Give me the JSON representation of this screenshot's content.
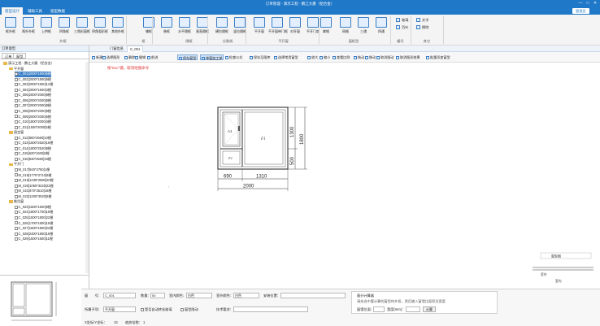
{
  "app": {
    "title": "订单管理 - 演示工程 - 鹏江大厦（铝合金）"
  },
  "window": {
    "min_icon": "minimize-icon",
    "max_icon": "maximize-icon",
    "close_icon": "close-icon",
    "min_glyph": "—",
    "max_glyph": "□",
    "close_glyph": "✕"
  },
  "tabs": [
    {
      "label": "窗型设计",
      "active": true
    },
    {
      "label": "辅助工具",
      "active": false
    },
    {
      "label": "窗型数据",
      "active": false
    }
  ],
  "user": {
    "label": "管理员"
  },
  "ribbon": {
    "buttons": [
      {
        "label": "框外框",
        "icon": "frame-icon"
      },
      {
        "label": "两外外框",
        "icon": "double-frame-icon"
      },
      {
        "label": "上拱框",
        "icon": "arch-frame-icon"
      },
      {
        "label": "四角框",
        "icon": "corner-frame-icon"
      },
      {
        "label": "三角形窗框",
        "icon": "triangle-frame-icon"
      },
      {
        "label": "四角弧形框",
        "icon": "arc-frame-icon"
      },
      {
        "label": "其他外框",
        "icon": "other-frame-icon"
      },
      {
        "label": "辅框",
        "icon": "aux-frame-icon"
      },
      {
        "label": "装框",
        "icon": "mount-frame-icon"
      },
      {
        "label": "水平隔框",
        "icon": "h-split-icon"
      },
      {
        "label": "垂直隔框",
        "icon": "v-split-icon"
      },
      {
        "label": "横拉隔框",
        "icon": "h-slide-icon"
      },
      {
        "label": "竖拉隔框",
        "icon": "v-slide-icon"
      },
      {
        "label": "平开窗",
        "icon": "casement-icon"
      },
      {
        "label": "平开窗带门框",
        "icon": "casement-door-icon"
      },
      {
        "label": "对开窗",
        "icon": "double-open-icon"
      },
      {
        "label": "平开门扇",
        "icon": "door-sash-icon"
      },
      {
        "label": "掌格",
        "icon": "grid-icon"
      },
      {
        "label": "网格",
        "icon": "mesh-icon"
      },
      {
        "label": "三通",
        "icon": "tee-icon"
      },
      {
        "label": "四通",
        "icon": "cross-icon"
      }
    ],
    "groups": [
      {
        "label": "外框"
      },
      {
        "label": "框"
      },
      {
        "label": "隔框"
      },
      {
        "label": "分割线"
      },
      {
        "label": "平开窗"
      },
      {
        "label": "窗框型"
      },
      {
        "label": "编号"
      },
      {
        "label": "其它"
      }
    ],
    "small": [
      {
        "label": "玻璃"
      },
      {
        "label": "百叶"
      },
      {
        "label": "文字"
      },
      {
        "label": "擦除"
      }
    ]
  },
  "leftpanel": {
    "header": "订单窗型",
    "subtabs": [
      {
        "label": "订单"
      },
      {
        "label": "窗型"
      }
    ],
    "tree": [
      {
        "label": "演示工程 - 鹏江大厦（铝合金）",
        "level": 0,
        "type": "folder"
      },
      {
        "label": "平开窗",
        "level": 1,
        "type": "folder"
      },
      {
        "label": "C_001[2000*1800]6樘",
        "level": 2,
        "type": "doc",
        "selected": true
      },
      {
        "label": "C_002[2000*1800]8樘",
        "level": 2,
        "type": "doc"
      },
      {
        "label": "C_003[2000*1800]12樘",
        "level": 2,
        "type": "doc"
      },
      {
        "label": "C_004[2000*1500]4樘",
        "level": 2,
        "type": "doc"
      },
      {
        "label": "C_005[2000*2000]8樘",
        "level": 2,
        "type": "doc"
      },
      {
        "label": "C_006[2000*2000]8樘",
        "level": 2,
        "type": "doc"
      },
      {
        "label": "C_007[2000*2000]8樘",
        "level": 2,
        "type": "doc"
      },
      {
        "label": "C_008[2000*2000]8樘",
        "level": 2,
        "type": "doc"
      },
      {
        "label": "C_009[2000*2000]6樘",
        "level": 2,
        "type": "doc"
      },
      {
        "label": "C_010[1800*2000]4樘",
        "level": 2,
        "type": "doc"
      },
      {
        "label": "C_011[1500*2000]5樘",
        "level": 2,
        "type": "doc"
      },
      {
        "label": "固定窗",
        "level": 1,
        "type": "folder"
      },
      {
        "label": "C_012[800*2560]10樘",
        "level": 2,
        "type": "doc"
      },
      {
        "label": "C_013[1500*2520]18樘",
        "level": 2,
        "type": "doc"
      },
      {
        "label": "C_014[1800*2520]8樘",
        "level": 2,
        "type": "doc"
      },
      {
        "label": "C_015[620*1600]8樘",
        "level": 2,
        "type": "doc"
      },
      {
        "label": "C_016[840*2560]18樘",
        "level": 2,
        "type": "doc"
      },
      {
        "label": "平开门",
        "level": 1,
        "type": "folder"
      },
      {
        "label": "M_017[840*2750]1樘",
        "level": 2,
        "type": "doc"
      },
      {
        "label": "M_018[1770*2710]8樘",
        "level": 2,
        "type": "doc"
      },
      {
        "label": "M_019[1438*2890]20樘",
        "level": 2,
        "type": "doc"
      },
      {
        "label": "M_020[1050*3225]22樘",
        "level": 2,
        "type": "doc"
      },
      {
        "label": "M_021[870*2510]18樘",
        "level": 2,
        "type": "doc"
      },
      {
        "label": "M_022[1200*3020]8樘",
        "level": 2,
        "type": "doc"
      },
      {
        "label": "推拉窗",
        "level": 1,
        "type": "folder"
      },
      {
        "label": "C_023[1500*1500]9樘",
        "level": 2,
        "type": "doc"
      },
      {
        "label": "C_024[1800*1700]18樘",
        "level": 2,
        "type": "doc"
      },
      {
        "label": "C_025[1500*1800]22樘",
        "level": 2,
        "type": "doc"
      },
      {
        "label": "C_026[1700*1800]15樘",
        "level": 2,
        "type": "doc"
      },
      {
        "label": "C_027[1500*1800]23樘",
        "level": 2,
        "type": "doc"
      },
      {
        "label": "C_028[2400*1800]19樘",
        "level": 2,
        "type": "doc"
      },
      {
        "label": "C_029[1500*1500]11樘",
        "level": 2,
        "type": "doc"
      }
    ]
  },
  "doctabs": [
    {
      "label": "门窗信息"
    },
    {
      "label": "C_001",
      "active": true
    }
  ],
  "toolbar": [
    {
      "label": "新建",
      "icon": "new-icon"
    },
    {
      "label": "选择图形",
      "icon": "select-icon"
    },
    {
      "label": "删除",
      "icon": "delete-icon"
    },
    {
      "label": "撤销",
      "icon": "undo-icon"
    },
    {
      "label": "前进",
      "icon": "redo-icon"
    },
    {
      "label": "保存窗型",
      "icon": "save-icon",
      "active": true
    },
    {
      "label": "单窗加工单",
      "icon": "worksheet-icon",
      "active": true
    },
    {
      "label": "检查公式",
      "icon": "formula-icon"
    },
    {
      "label": "保存至图库",
      "icon": "library-icon"
    },
    {
      "label": "选择常用窗型",
      "icon": "common-icon"
    },
    {
      "label": "放大",
      "icon": "zoom-in-icon"
    },
    {
      "label": "缩小",
      "icon": "zoom-out-icon"
    },
    {
      "label": "查看比例",
      "icon": "ratio-icon"
    },
    {
      "label": "拖动",
      "icon": "drag-icon"
    },
    {
      "label": "移动",
      "icon": "move-icon"
    },
    {
      "label": "取消限动",
      "icon": "unlock-icon"
    },
    {
      "label": "取消图形效果",
      "icon": "effect-icon"
    },
    {
      "label": "批量添加窗型",
      "icon": "batch-add-icon"
    }
  ],
  "canvas": {
    "hint": "按\"Esc\"键，取消绘图命令",
    "dims": {
      "d690": "690",
      "d1310": "1310",
      "d2000": "2000",
      "d1300": "1300",
      "d500": "500",
      "d1800": "1800"
    },
    "sash_label": "A1",
    "fixed_label": "F1",
    "fixed_label2": "F1",
    "corner": {
      "selector": "窗型图",
      "left": "室外",
      "right": "室内"
    }
  },
  "props": {
    "window_no_label": "窗　　号：",
    "window_no": "C_001",
    "qty_label": "数量：",
    "qty": "50",
    "inner_color_label": "室内颜色：",
    "inner_color": "白色",
    "outer_color_label": "室外颜色：",
    "outer_color": "白色",
    "install_label": "安装位置：",
    "install": "",
    "series_label": "所属子项：",
    "series": "平开窗",
    "auto_label": "是否自动转化玻璃",
    "link_label": "窗型限动",
    "tech_label": "技术要求：",
    "tech": ""
  },
  "calc": {
    "title": "窗分计算器",
    "desc": "请先选中要计算的窗型的外框，然后输入窗墙比面积及宽度",
    "area_label": "窗墙位面：",
    "area_value": "",
    "width_label": "宽度(mm)：",
    "width_value": "",
    "btn": "计算"
  },
  "status": {
    "coord_label": "X坐标/Y坐标：",
    "coord_value": "15",
    "scale_label": "缩放倍数：",
    "scale_value": "1"
  }
}
